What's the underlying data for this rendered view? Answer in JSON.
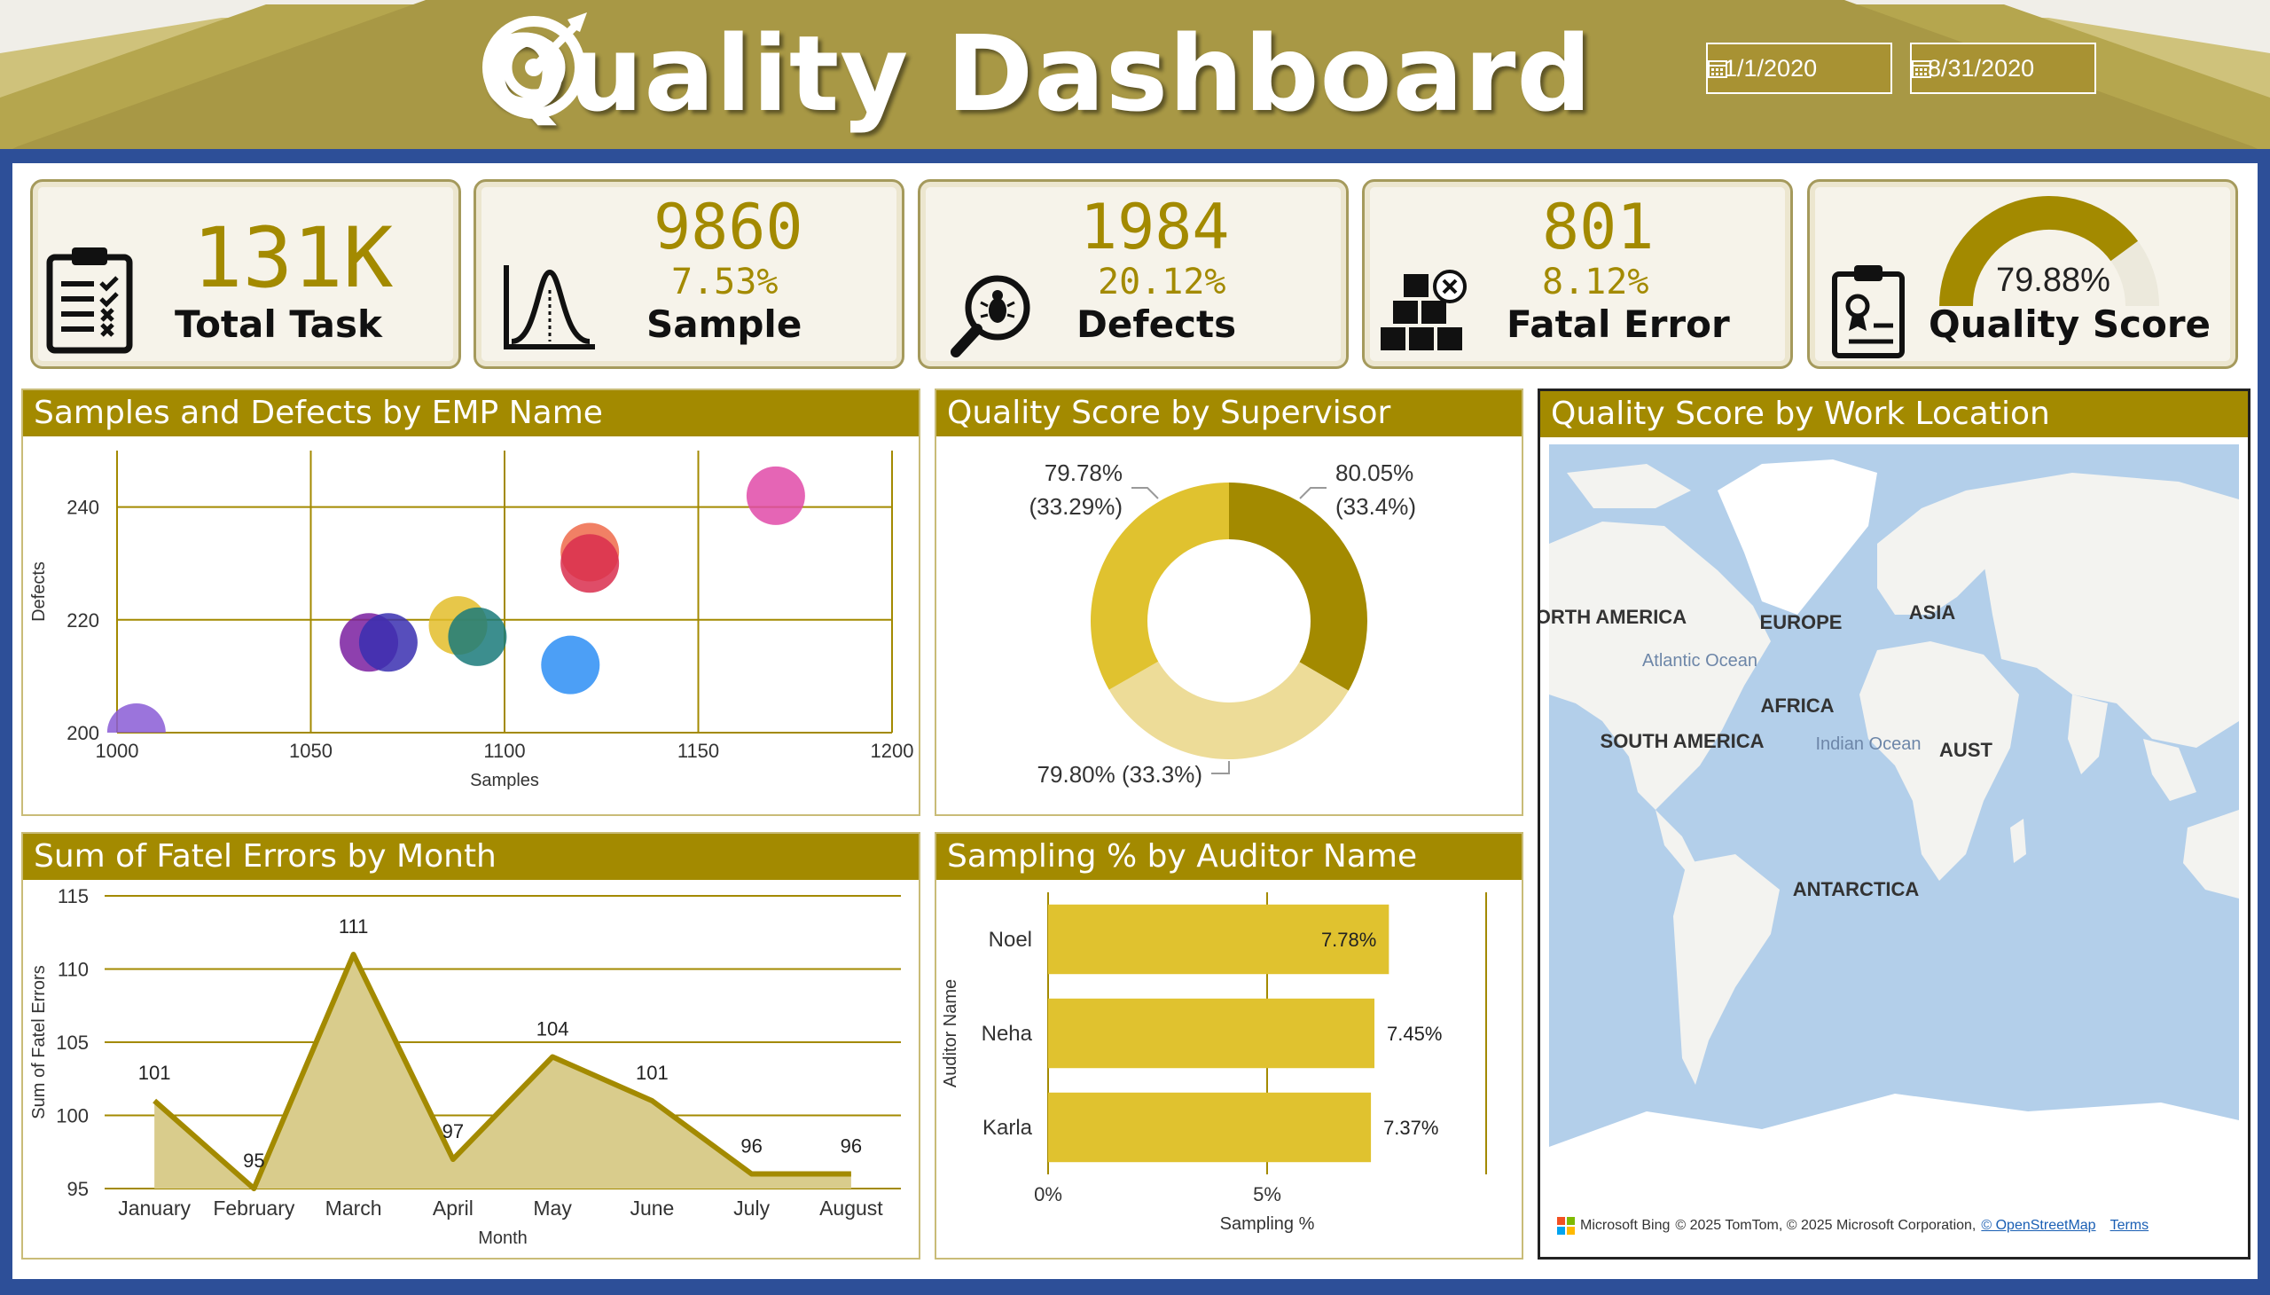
{
  "header": {
    "title": "Quality Dashboard",
    "icon": "target-icon",
    "start_date": "1/1/2020",
    "end_date": "8/31/2020"
  },
  "colors": {
    "gold": "#a38a00",
    "banner": "#a89845",
    "frame": "#2d4f98"
  },
  "kpis": {
    "total_task": {
      "value": "131K",
      "label": "Total Task",
      "icon": "clipboard-checklist-icon"
    },
    "sample": {
      "value": "9860",
      "pct": "7.53%",
      "label": "Sample",
      "icon": "bell-curve-icon"
    },
    "defects": {
      "value": "1984",
      "pct": "20.12%",
      "label": "Defects",
      "icon": "bug-magnifier-icon"
    },
    "fatal_error": {
      "value": "801",
      "pct": "8.12%",
      "label": "Fatal Error",
      "icon": "boxes-error-icon"
    },
    "quality_score": {
      "value": "79.88%",
      "label": "Quality Score",
      "gauge_fraction": 0.7988,
      "icon": "certificate-icon"
    }
  },
  "panels": {
    "scatter_title": "Samples and Defects by EMP Name",
    "donut_title": "Quality Score by Supervisor",
    "map_title": "Quality Score by Work Location",
    "area_title": "Sum of Fatel Errors by Month",
    "bar_title": "Sampling % by Auditor Name"
  },
  "map": {
    "labels": [
      "NORTH AMERICA",
      "EUROPE",
      "ASIA",
      "AFRICA",
      "SOUTH AMERICA",
      "ANTARCTICA",
      "AUST"
    ],
    "ocean_labels": [
      "Atlantic Ocean",
      "Indian Ocean"
    ],
    "attribution": "Microsoft Bing",
    "copyright": "© 2025 TomTom, © 2025 Microsoft Corporation,",
    "osm_link": "© OpenStreetMap",
    "terms_link": "Terms"
  },
  "chart_data": [
    {
      "type": "scatter",
      "title": "Samples and Defects by EMP Name",
      "xlabel": "Samples",
      "ylabel": "Defects",
      "xlim": [
        1000,
        1200
      ],
      "ylim": [
        200,
        250
      ],
      "xticks": [
        1000,
        1050,
        1100,
        1150,
        1200
      ],
      "yticks": [
        200,
        220,
        240
      ],
      "points": [
        {
          "x": 1005,
          "y": 200,
          "color": "#8a5cd6"
        },
        {
          "x": 1065,
          "y": 216,
          "color": "#7a1fa0"
        },
        {
          "x": 1070,
          "y": 216,
          "color": "#3a2fb0"
        },
        {
          "x": 1088,
          "y": 219,
          "color": "#e3bd2a"
        },
        {
          "x": 1093,
          "y": 217,
          "color": "#1a7a7a"
        },
        {
          "x": 1117,
          "y": 212,
          "color": "#2d8ef5"
        },
        {
          "x": 1122,
          "y": 232,
          "color": "#ee6a4a"
        },
        {
          "x": 1122,
          "y": 230,
          "color": "#d92e4e"
        },
        {
          "x": 1170,
          "y": 242,
          "color": "#e04aa8"
        }
      ]
    },
    {
      "type": "pie",
      "title": "Quality Score by Supervisor",
      "slices": [
        {
          "value": 80.05,
          "label": "80.05%",
          "share": "(33.4%)",
          "color": "#a38a00"
        },
        {
          "value": 79.8,
          "label": "79.80% (33.3%)",
          "share": "",
          "color": "#eddc98"
        },
        {
          "value": 79.78,
          "label": "79.78%",
          "share": "(33.29%)",
          "color": "#e0c22f"
        }
      ]
    },
    {
      "type": "area",
      "title": "Sum of Fatel Errors by Month",
      "xlabel": "Month",
      "ylabel": "Sum of Fatel Errors",
      "categories": [
        "January",
        "February",
        "March",
        "April",
        "May",
        "June",
        "July",
        "August"
      ],
      "values": [
        101,
        95,
        111,
        97,
        104,
        101,
        96,
        96
      ],
      "ylim": [
        95,
        115
      ],
      "yticks": [
        95,
        100,
        105,
        110,
        115
      ]
    },
    {
      "type": "bar",
      "title": "Sampling % by Auditor Name",
      "xlabel": "Sampling %",
      "ylabel": "Auditor Name",
      "categories": [
        "Noel",
        "Neha",
        "Karla"
      ],
      "values": [
        7.78,
        7.45,
        7.37
      ],
      "value_labels": [
        "7.78%",
        "7.45%",
        "7.37%"
      ],
      "xticks": [
        "0%",
        "5%"
      ],
      "xlim": [
        0,
        10
      ]
    }
  ]
}
